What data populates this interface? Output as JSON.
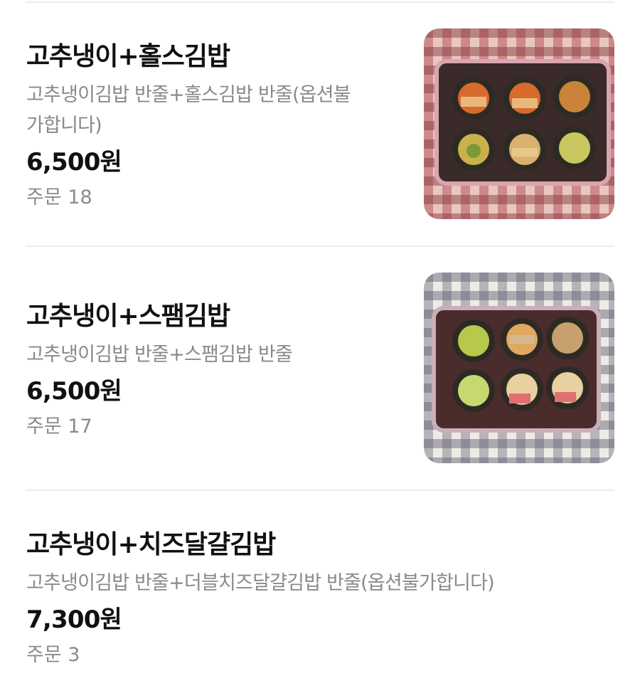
{
  "menu": {
    "items": [
      {
        "name": "고추냉이+홀스김밥",
        "description": "고추냉이김밥 반줄+홀스김밥 반줄(옵션불\n가합니다)",
        "price": "6,500원",
        "orders": "주문 18",
        "image_icon": "kimbap-photo-icon"
      },
      {
        "name": "고추냉이+스팸김밥",
        "description": "고추냉이김밥 반줄+스팸김밥 반줄",
        "price": "6,500원",
        "orders": "주문 17",
        "image_icon": "kimbap-photo-icon"
      },
      {
        "name": "고추냉이+치즈달걀김밥",
        "description": "고추냉이김밥 반줄+더블치즈달걀김밥 반줄(옵션불가합니다)",
        "price": "7,300원",
        "orders": "주문 3"
      }
    ]
  },
  "colors": {
    "text": "#111111",
    "subtext": "#8a8a8a",
    "divider": "#ececec",
    "checker_red": "#c84a4a",
    "checker_gray": "#8f8f9a"
  }
}
